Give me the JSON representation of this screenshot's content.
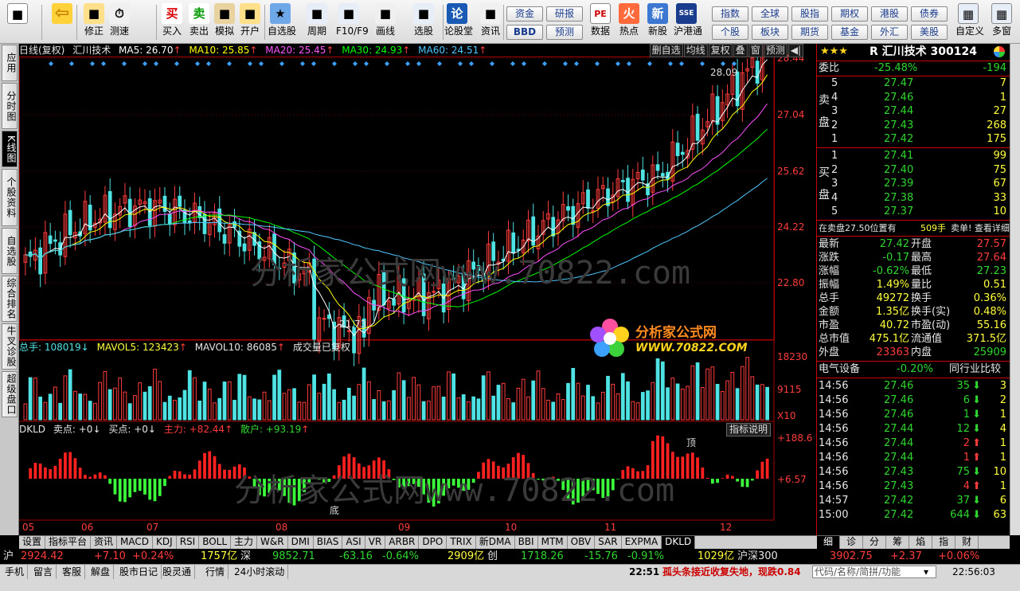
{
  "toolbar": {
    "buttons": [
      {
        "label": "",
        "icon": "grid-icon"
      },
      {
        "label": "",
        "icon": "back-arrow-icon"
      },
      {
        "label": "修正",
        "icon": "refresh-icon"
      },
      {
        "label": "测速",
        "icon": "clock-icon"
      },
      {
        "label": "买入",
        "icon": "buy-icon",
        "glyph": "买"
      },
      {
        "label": "卖出",
        "icon": "sell-icon",
        "glyph": "卖"
      },
      {
        "label": "模拟",
        "icon": "hammer-icon"
      },
      {
        "label": "开户",
        "icon": "lock-icon"
      },
      {
        "label": "自选股",
        "icon": "star-icon"
      },
      {
        "label": "周期",
        "icon": "cycle-icon"
      },
      {
        "label": "F10/F9",
        "icon": "f10-icon"
      },
      {
        "label": "画线",
        "icon": "pen-icon"
      },
      {
        "label": "选股",
        "icon": "select-icon"
      },
      {
        "label": "论股堂",
        "icon": "forum-icon",
        "glyph": "论"
      },
      {
        "label": "资讯",
        "icon": "news-icon"
      }
    ],
    "mini_left": [
      [
        "资金",
        "研报"
      ],
      [
        "BBD",
        "预测"
      ]
    ],
    "buttons2": [
      {
        "label": "数据",
        "icon": "pe-icon",
        "glyph": "PE"
      },
      {
        "label": "热点",
        "icon": "hot-icon"
      },
      {
        "label": "新股",
        "icon": "newstock-icon"
      },
      {
        "label": "沪港通",
        "icon": "sse-hke-icon"
      }
    ],
    "mini_right": [
      [
        "指数",
        "全球",
        "股指",
        "期权",
        "港股",
        "债券"
      ],
      [
        "个股",
        "板块",
        "期货",
        "基金",
        "外汇",
        "美股"
      ]
    ],
    "buttons3": [
      {
        "label": "自定义",
        "icon": "custom-icon"
      },
      {
        "label": "多窗",
        "icon": "multiwin-icon"
      }
    ]
  },
  "left_tabs": [
    "应用",
    "分时图",
    "K线图",
    "个股资料",
    "自选股",
    "综合排名",
    "牛叉诊股",
    "超级盘口"
  ],
  "chart_header": {
    "period": "日线(复权)",
    "name": "汇川技术",
    "ma5": "MA5: 26.70",
    "ma10": "MA10: 25.85",
    "ma20": "MA20: 25.45",
    "ma30": "MA30: 24.93",
    "ma60": "MA60: 24.51",
    "top_buttons": [
      "删自选",
      "均线",
      "复权",
      "叠",
      "窗",
      "预测"
    ]
  },
  "price_axis": [
    "28.44",
    "27.04",
    "25.62",
    "24.22",
    "22.80"
  ],
  "price_high_label": "28.09",
  "price_low_label": "21.73",
  "watermark_main": "分析家公式网www.70822.com",
  "watermark_logo": "分析家公式网",
  "watermark_url": "WWW.70822.COM",
  "vol_header": {
    "total": "总手: 108019",
    "mavol5": "MAVOL5: 123423",
    "mavol10": "MAVOL10: 86085",
    "note": "成交量已复权"
  },
  "vol_axis": [
    "18230",
    "9115",
    "X10"
  ],
  "dkld_header": {
    "name": "DKLD",
    "sell": "卖点: +0",
    "buy": "买点: +0",
    "main": "主力: +82.44",
    "retail": "散户: +93.19",
    "btn": "指标说明"
  },
  "dkld_axis": [
    "+188.6",
    "+6.57"
  ],
  "dkld_marks": [
    "顶",
    "底"
  ],
  "months": [
    "05",
    "06",
    "07",
    "08",
    "09",
    "10",
    "11",
    "12"
  ],
  "bottom_tabs": [
    "设置",
    "指标平台",
    "资讯",
    "MACD",
    "KDJ",
    "RSI",
    "BOLL",
    "主力",
    "W&R",
    "DMI",
    "BIAS",
    "ASI",
    "VR",
    "ARBR",
    "DPO",
    "TRIX",
    "新DMA",
    "BBI",
    "MTM",
    "OBV",
    "SAR",
    "EXPMA",
    "DKLD"
  ],
  "right_tabs": [
    "细",
    "诊",
    "分",
    "筹",
    "焰",
    "指",
    "财"
  ],
  "quote": {
    "title": "R 汇川技术 300124",
    "weibi_label": "委比",
    "weibi": "-25.48%",
    "weicha": "-194",
    "sell_side": "卖盘",
    "buy_side": "买盘",
    "asks": [
      [
        "5",
        "27.47",
        "7"
      ],
      [
        "4",
        "27.46",
        "1"
      ],
      [
        "3",
        "27.44",
        "27"
      ],
      [
        "2",
        "27.43",
        "268"
      ],
      [
        "1",
        "27.42",
        "175"
      ]
    ],
    "bids": [
      [
        "1",
        "27.41",
        "99"
      ],
      [
        "2",
        "27.40",
        "75"
      ],
      [
        "3",
        "27.39",
        "67"
      ],
      [
        "4",
        "27.38",
        "33"
      ],
      [
        "5",
        "27.37",
        "10"
      ]
    ],
    "notice": "在卖盘27.50位置有",
    "notice_vol": "509手",
    "notice_tail": "卖单! 查看详细",
    "stats": [
      [
        "最新",
        "27.42",
        "开盘",
        "27.57"
      ],
      [
        "涨跌",
        "-0.17",
        "最高",
        "27.64"
      ],
      [
        "涨幅",
        "-0.62%",
        "最低",
        "27.23"
      ],
      [
        "振幅",
        "1.49%",
        "量比",
        "0.51"
      ],
      [
        "总手",
        "49272",
        "换手",
        "0.36%"
      ],
      [
        "金额",
        "1.35亿",
        "换手(实)",
        "0.48%"
      ],
      [
        "市盈",
        "40.72",
        "市盈(动)",
        "55.16"
      ],
      [
        "总市值",
        "475.1亿",
        "流通值",
        "371.5亿"
      ],
      [
        "外盘",
        "23363",
        "内盘",
        "25909"
      ]
    ],
    "sector": "电气设备",
    "sector_chg": "-0.20%",
    "sector_btn": "同行业比较",
    "ticks": [
      [
        "14:56",
        "27.46",
        "35",
        "down",
        "3"
      ],
      [
        "14:56",
        "27.46",
        "6",
        "down",
        "2"
      ],
      [
        "14:56",
        "27.46",
        "1",
        "down",
        "1"
      ],
      [
        "14:56",
        "27.44",
        "12",
        "down",
        "4"
      ],
      [
        "14:56",
        "27.44",
        "2",
        "up",
        "1"
      ],
      [
        "14:56",
        "27.44",
        "1",
        "up",
        "1"
      ],
      [
        "14:56",
        "27.43",
        "75",
        "down",
        "10"
      ],
      [
        "14:56",
        "27.43",
        "4",
        "up",
        "1"
      ],
      [
        "14:57",
        "27.42",
        "37",
        "down",
        "6"
      ],
      [
        "15:00",
        "27.42",
        "644",
        "down",
        "63"
      ]
    ]
  },
  "index_bar": {
    "sh_label": "沪",
    "sh": "2924.42",
    "sh_chg": "+7.10",
    "sh_pct": "+0.24%",
    "sh_amt": "1757亿",
    "sz_label": "深",
    "sz": "9852.71",
    "sz_chg": "-63.16",
    "sz_pct": "-0.64%",
    "sz_amt": "2909亿",
    "cy_label": "创",
    "cy": "1718.26",
    "cy_chg": "-15.76",
    "cy_pct": "-0.91%",
    "cy_amt": "1029亿",
    "hs_label": "沪深300",
    "hs": "3902.75",
    "hs_chg": "+2.37",
    "hs_pct": "+0.06%"
  },
  "status": {
    "items": [
      "手机",
      "留言",
      "客服",
      "解盘",
      "股市日记",
      "股灵通",
      "行情",
      "24小时滚动"
    ],
    "news_time": "22:51",
    "news": "孤头条接近收复失地，现跌0.84",
    "search_placeholder": "代码/名称/简拼/功能",
    "clock": "22:56:03"
  },
  "colors": {
    "up": "#ff3c3c",
    "down": "#4fe3e3",
    "ma5": "#ffffff",
    "ma10": "#ffff00",
    "ma20": "#ff50ff",
    "ma30": "#00ff00",
    "ma60": "#4fc8ff"
  }
}
